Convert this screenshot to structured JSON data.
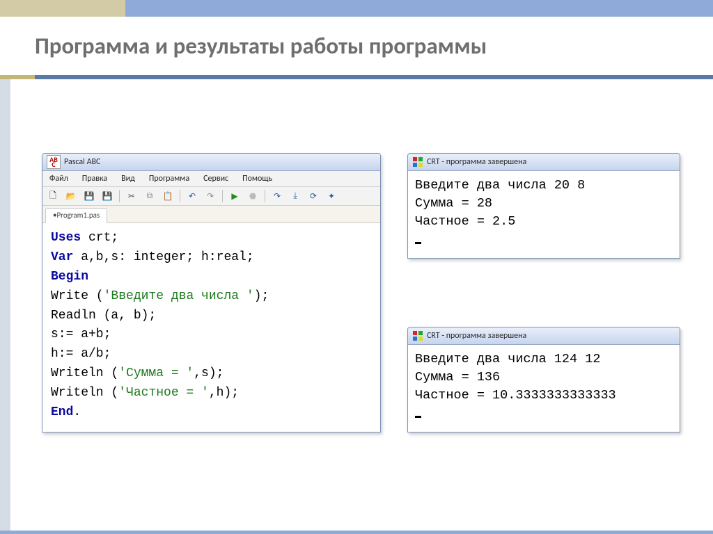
{
  "slide": {
    "title": "Программа и результаты работы программы"
  },
  "pascal_window": {
    "title": "Pascal ABC",
    "menu": [
      "Файл",
      "Правка",
      "Вид",
      "Программа",
      "Сервис",
      "Помощь"
    ],
    "tab": "•Program1.pas",
    "code": {
      "l1_kw": "Uses",
      "l1_rest": " crt;",
      "l2_kw": "Var",
      "l2_rest": " a,b,s: integer; h:real;",
      "l3_kw": "Begin",
      "l4a": "Write (",
      "l4s": "'Введите два числа '",
      "l4b": ");",
      "l5": "Readln (a, b);",
      "l6": "s:= a+b;",
      "l7": "h:= a/b;",
      "l8a": "Writeln (",
      "l8s": "'Сумма = '",
      "l8b": ",s);",
      "l9a": "Writeln (",
      "l9s": "'Частное = '",
      "l9b": ",h);",
      "l10_kw": "End",
      "l10_rest": "."
    }
  },
  "crt1": {
    "title": "CRT - программа завершена",
    "line1": "Введите два числа 20 8",
    "line2": "Сумма = 28",
    "line3": "Частное = 2.5"
  },
  "crt2": {
    "title": "CRT - программа завершена",
    "line1": "Введите два числа 124 12",
    "line2": "Сумма = 136",
    "line3": "Частное = 10.3333333333333"
  }
}
